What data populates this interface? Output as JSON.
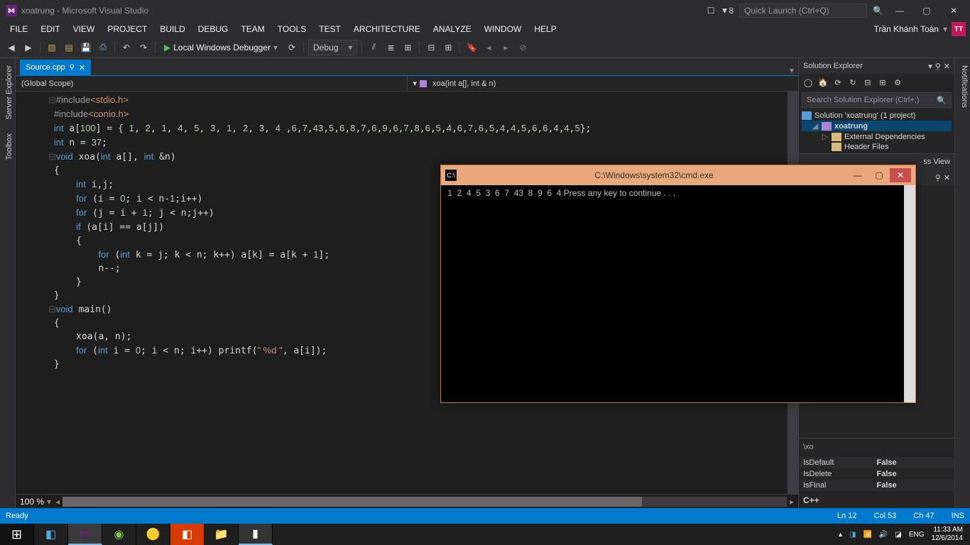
{
  "titlebar": {
    "title": "xoatrung - Microsoft Visual Studio",
    "notif_count": "8",
    "quicklaunch_placeholder": "Quick Launch (Ctrl+Q)"
  },
  "menubar": {
    "items": [
      "FILE",
      "EDIT",
      "VIEW",
      "PROJECT",
      "BUILD",
      "DEBUG",
      "TEAM",
      "TOOLS",
      "TEST",
      "ARCHITECTURE",
      "ANALYZE",
      "WINDOW",
      "HELP"
    ],
    "username": "Trần Khánh Toàn",
    "userbadge": "TT"
  },
  "toolbar": {
    "debugger_label": "Local Windows Debugger",
    "config": "Debug"
  },
  "editor": {
    "tab": "Source.cpp",
    "scope": "(Global Scope)",
    "member": "xoa(int a[], int & n)",
    "zoom": "100 %"
  },
  "solution_explorer": {
    "title": "Solution Explorer",
    "search_placeholder": "Search Solution Explorer (Ctrl+;)",
    "solution": "Solution 'xoatrung' (1 project)",
    "project": "xoatrung",
    "ext_deps": "External Dependencies",
    "header_files": "Header Files"
  },
  "class_view": {
    "title_suffix": "ss View",
    "path_suffix": "\\xo"
  },
  "properties": {
    "rows": [
      {
        "name": "IsDefault",
        "value": "False"
      },
      {
        "name": "IsDelete",
        "value": "False"
      },
      {
        "name": "IsFinal",
        "value": "False"
      }
    ],
    "category": "C++"
  },
  "statusbar": {
    "ready": "Ready",
    "line": "Ln 12",
    "col": "Col 53",
    "ch": "Ch 47",
    "ins": "INS"
  },
  "cmd": {
    "title": "C:\\Windows\\system32\\cmd.exe",
    "output": " 1  2  4  5  3  6  7  43  8  9  6  4 Press any key to continue . . ."
  },
  "taskbar": {
    "lang": "ENG",
    "time": "11:33 AM",
    "date": "12/6/2014"
  },
  "right_rail": {
    "label": "Notifications"
  }
}
